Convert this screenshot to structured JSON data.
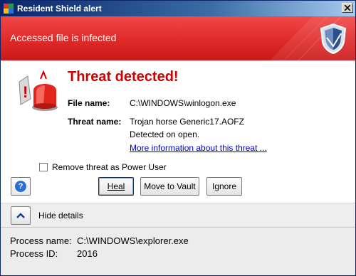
{
  "window": {
    "title": "Resident Shield alert",
    "app_icon": "avg-logo-icon",
    "close_icon": "close-icon"
  },
  "banner": {
    "title": "Accessed file is infected",
    "logo_icon": "shield-icon",
    "bg_color": "#e02a2a"
  },
  "alert": {
    "headline": "Threat detected!",
    "headline_color": "#cc0000",
    "icon": "alarm-siren-icon",
    "file_name_label": "File name:",
    "file_name_value": "C:\\WINDOWS\\winlogon.exe",
    "threat_name_label": "Threat name:",
    "threat_name_value": "Trojan horse Generic17.AOFZ",
    "detected_text": "Detected on open.",
    "more_info_link": "More information about this threat ..."
  },
  "options": {
    "power_user_label": "Remove threat as Power User",
    "power_user_checked": false
  },
  "buttons": {
    "help_icon": "help-icon",
    "heal": "Heal",
    "move_to_vault": "Move to Vault",
    "ignore": "Ignore"
  },
  "details": {
    "toggle_icon": "chevron-up-icon",
    "label": "Hide details",
    "process_name_label": "Process name:",
    "process_name_value": "C:\\WINDOWS\\explorer.exe",
    "process_id_label": "Process ID:",
    "process_id_value": "2016"
  }
}
